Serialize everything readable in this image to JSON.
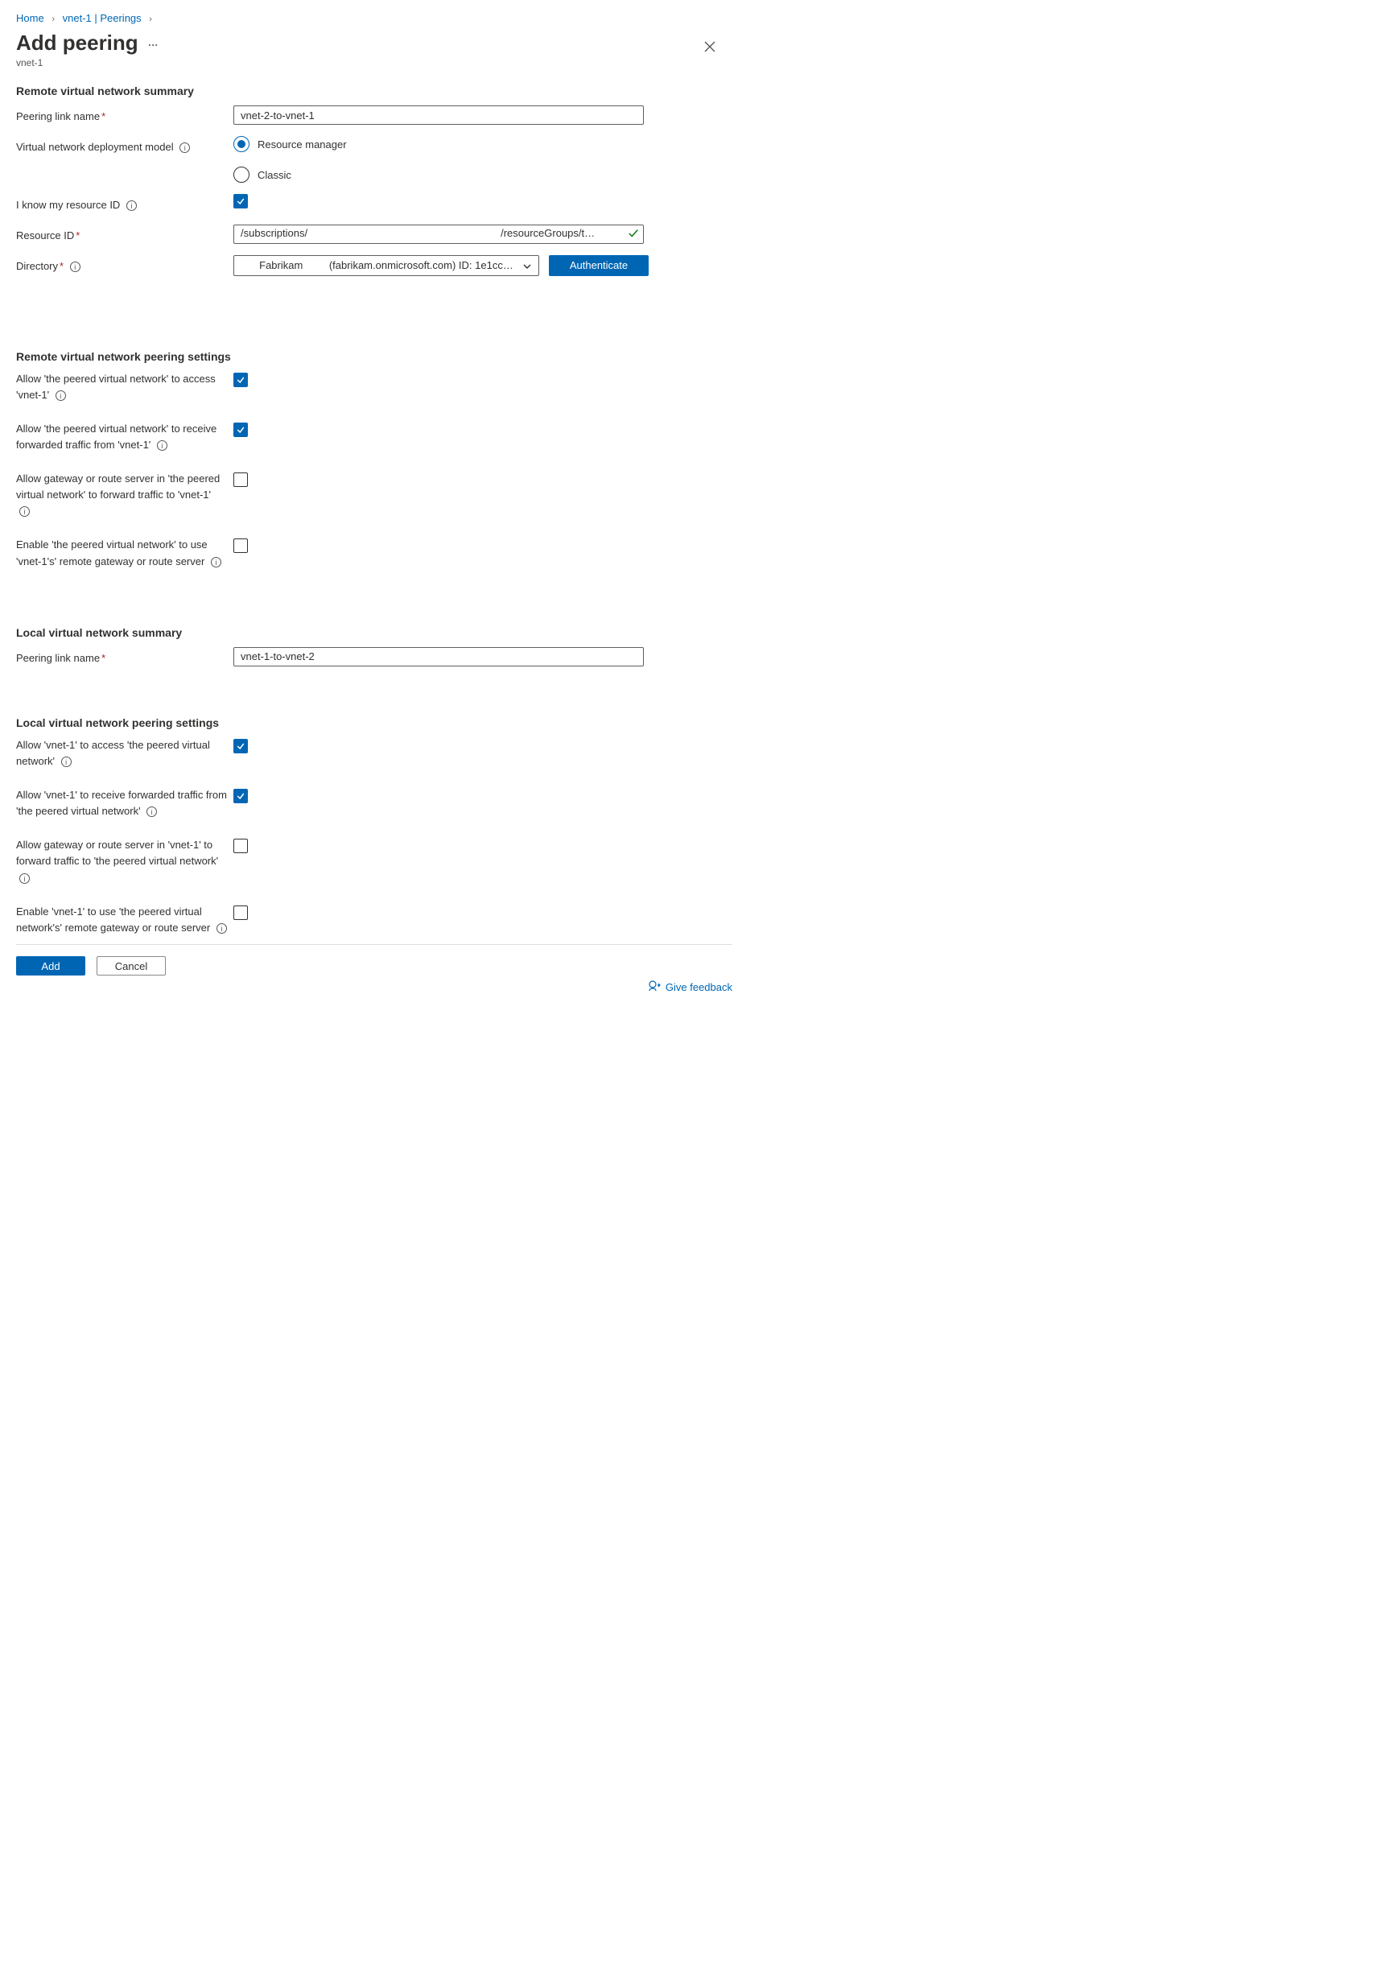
{
  "breadcrumb": {
    "home": "Home",
    "vnet": "vnet-1 | Peerings"
  },
  "header": {
    "title": "Add peering",
    "subtitle": "vnet-1"
  },
  "sections": {
    "remote_summary": "Remote virtual network summary",
    "remote_settings": "Remote virtual network peering settings",
    "local_summary": "Local virtual network summary",
    "local_settings": "Local virtual network peering settings"
  },
  "labels": {
    "peering_link_name": "Peering link name",
    "deployment_model": "Virtual network deployment model",
    "know_resource_id": "I know my resource ID",
    "resource_id": "Resource ID",
    "directory": "Directory"
  },
  "values": {
    "remote_peering_name": "vnet-2-to-vnet-1",
    "local_peering_name": "vnet-1-to-vnet-2",
    "resource_id_left": "/subscriptions/",
    "resource_id_right": "/resourceGroups/t…",
    "directory_display": "Fabrikam         (fabrikam.onmicrosoft.com) ID: 1e1cc…"
  },
  "radios": {
    "resource_manager": "Resource manager",
    "classic": "Classic"
  },
  "buttons": {
    "authenticate": "Authenticate",
    "add": "Add",
    "cancel": "Cancel",
    "feedback": "Give feedback"
  },
  "remote_opts": {
    "allow_access": "Allow 'the peered virtual network' to access 'vnet-1'",
    "allow_forwarded": "Allow 'the peered virtual network' to receive forwarded traffic from 'vnet-1'",
    "allow_gateway": "Allow gateway or route server in 'the peered virtual network' to forward traffic to 'vnet-1'",
    "enable_remote_gw": "Enable 'the peered virtual network' to use 'vnet-1's' remote gateway or route server"
  },
  "local_opts": {
    "allow_access": "Allow 'vnet-1' to access 'the peered virtual network'",
    "allow_forwarded": "Allow 'vnet-1' to receive forwarded traffic from 'the peered virtual network'",
    "allow_gateway": "Allow gateway or route server in 'vnet-1' to forward traffic to 'the peered virtual network'",
    "enable_remote_gw": "Enable 'vnet-1' to use 'the peered virtual network's' remote gateway or route server"
  },
  "states": {
    "deployment_model_selected": "resource_manager",
    "know_resource_id_checked": true,
    "remote_allow_access": true,
    "remote_allow_forwarded": true,
    "remote_allow_gateway": false,
    "remote_enable_remote_gw": false,
    "local_allow_access": true,
    "local_allow_forwarded": true,
    "local_allow_gateway": false,
    "local_enable_remote_gw": false
  }
}
